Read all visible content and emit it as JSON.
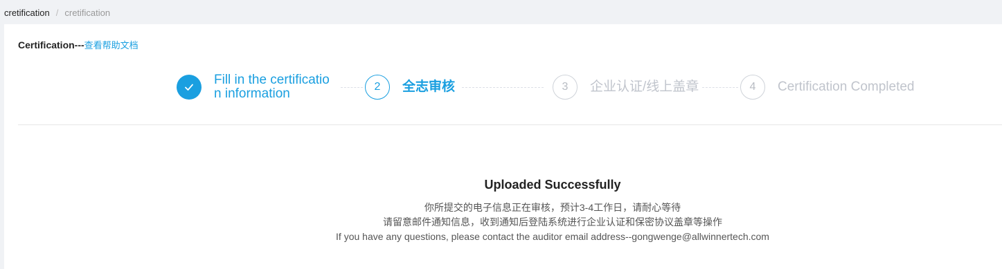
{
  "breadcrumb": {
    "items": [
      "cretification",
      "cretification"
    ],
    "separator": "/"
  },
  "header": {
    "title": "Certification---",
    "help_link": "查看帮助文档"
  },
  "steps": [
    {
      "number": "1",
      "title": "Fill in the certification information",
      "status": "done",
      "icon": "check-icon"
    },
    {
      "number": "2",
      "title": "全志审核",
      "status": "active"
    },
    {
      "number": "3",
      "title": "企业认证/线上盖章",
      "status": "wait"
    },
    {
      "number": "4",
      "title": "Certification Completed",
      "status": "wait"
    }
  ],
  "result": {
    "title": "Uploaded Successfully",
    "lines": [
      "你所提交的电子信息正在审核，预计3-4工作日，请耐心等待",
      "请留意邮件通知信息，收到通知后登陆系统进行企业认证和保密协议盖章等操作",
      "If you have any questions, please contact the auditor email address--gongwenge@allwinnertech.com"
    ]
  },
  "colors": {
    "accent": "#1a9fe0",
    "inactive": "#c0c4cc",
    "background": "#f0f2f5"
  }
}
